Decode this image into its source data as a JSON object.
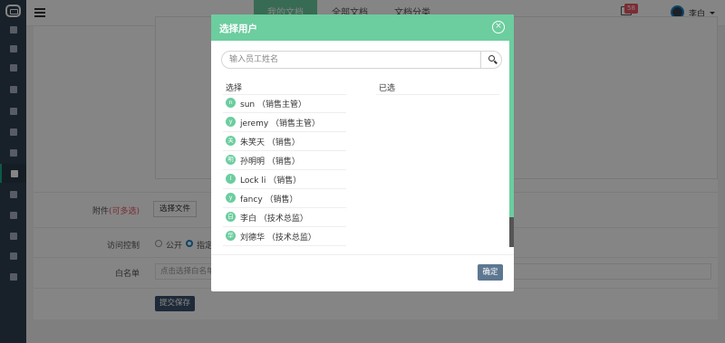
{
  "topbar": {
    "tabs": [
      "我的文档",
      "全部文档",
      "文档分类"
    ],
    "mail_badge": "58",
    "user_name": "李白"
  },
  "sidebar": {
    "icons": [
      "home-icon",
      "list-icon",
      "briefcase-icon",
      "users-icon",
      "calendar-icon",
      "list-alt-icon",
      "book-icon",
      "columns-icon",
      "male-icon",
      "image-icon",
      "bullhorn-icon",
      "gavel-icon",
      "cogs-icon"
    ]
  },
  "form": {
    "attachment_label": "附件",
    "attachment_hint": "(可多选)",
    "choose_file": "选择文件",
    "access_label": "访问控制",
    "access_public": "公开",
    "access_specified": "指定",
    "whitelist_label": "白名单",
    "whitelist_placeholder": "点击选择白名单",
    "submit": "提交保存"
  },
  "modal": {
    "title": "选择用户",
    "search_placeholder": "输入员工姓名",
    "col_choose": "选择",
    "col_selected": "已选",
    "confirm": "确定",
    "users": [
      {
        "initial": "n",
        "name": "sun  （销售主管）"
      },
      {
        "initial": "y",
        "name": "jeremy  （销售主管）"
      },
      {
        "initial": "关",
        "name": "朱笑天  （销售）"
      },
      {
        "initial": "明",
        "name": "孙明明  （销售）"
      },
      {
        "initial": "l",
        "name": "Lock li  （销售）"
      },
      {
        "initial": "y",
        "name": "fancy  （销售）"
      },
      {
        "initial": "白",
        "name": "李白  （技术总监）"
      },
      {
        "initial": "华",
        "name": "刘德华  （技术总监）"
      }
    ]
  }
}
